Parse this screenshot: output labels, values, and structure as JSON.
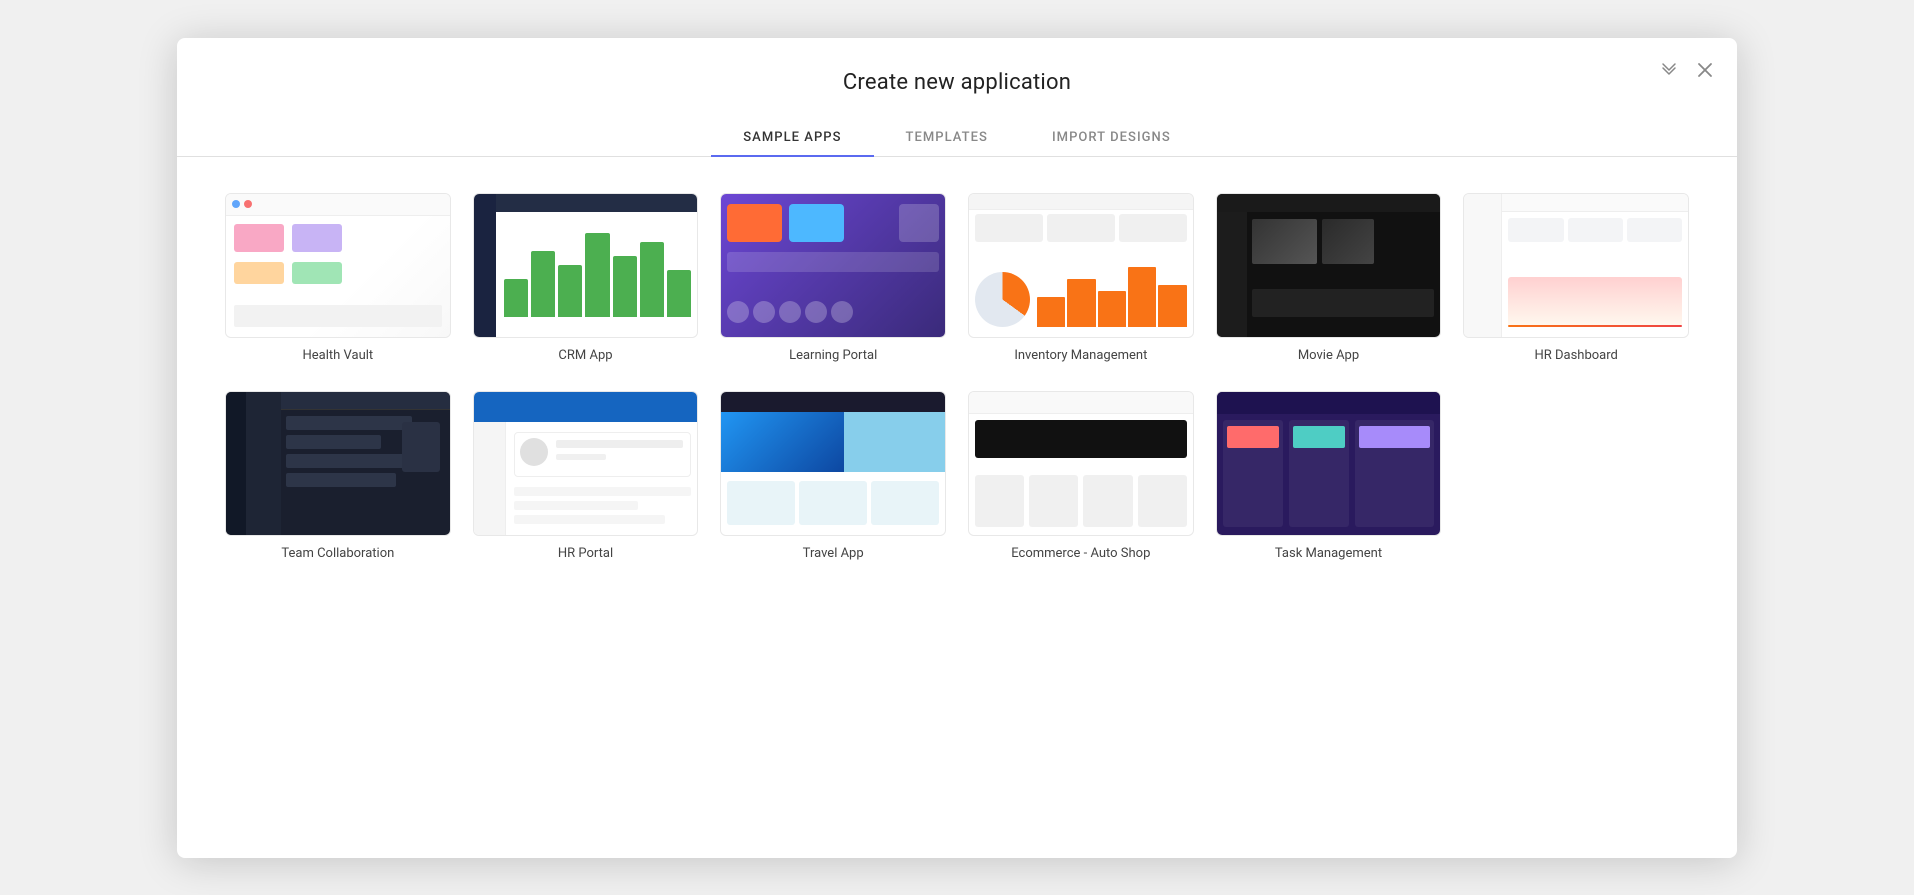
{
  "modal": {
    "title": "Create new application",
    "minimize_label": "minimize",
    "close_label": "close"
  },
  "tabs": [
    {
      "id": "sample-apps",
      "label": "SAMPLE APPS",
      "active": true
    },
    {
      "id": "templates",
      "label": "TEMPLATES",
      "active": false
    },
    {
      "id": "import-designs",
      "label": "IMPORT DESIGNS",
      "active": false
    }
  ],
  "apps_row1": [
    {
      "id": "health-vault",
      "label": "Health Vault"
    },
    {
      "id": "crm-app",
      "label": "CRM App"
    },
    {
      "id": "learning-portal",
      "label": "Learning Portal"
    },
    {
      "id": "inventory-management",
      "label": "Inventory Management"
    },
    {
      "id": "movie-app",
      "label": "Movie App"
    },
    {
      "id": "hr-dashboard",
      "label": "HR Dashboard"
    }
  ],
  "apps_row2": [
    {
      "id": "team-collaboration",
      "label": "Team Collaboration"
    },
    {
      "id": "hr-portal",
      "label": "HR Portal"
    },
    {
      "id": "travel-app",
      "label": "Travel App"
    },
    {
      "id": "ecommerce-auto-shop",
      "label": "Ecommerce - Auto Shop"
    },
    {
      "id": "task-management",
      "label": "Task Management"
    }
  ]
}
